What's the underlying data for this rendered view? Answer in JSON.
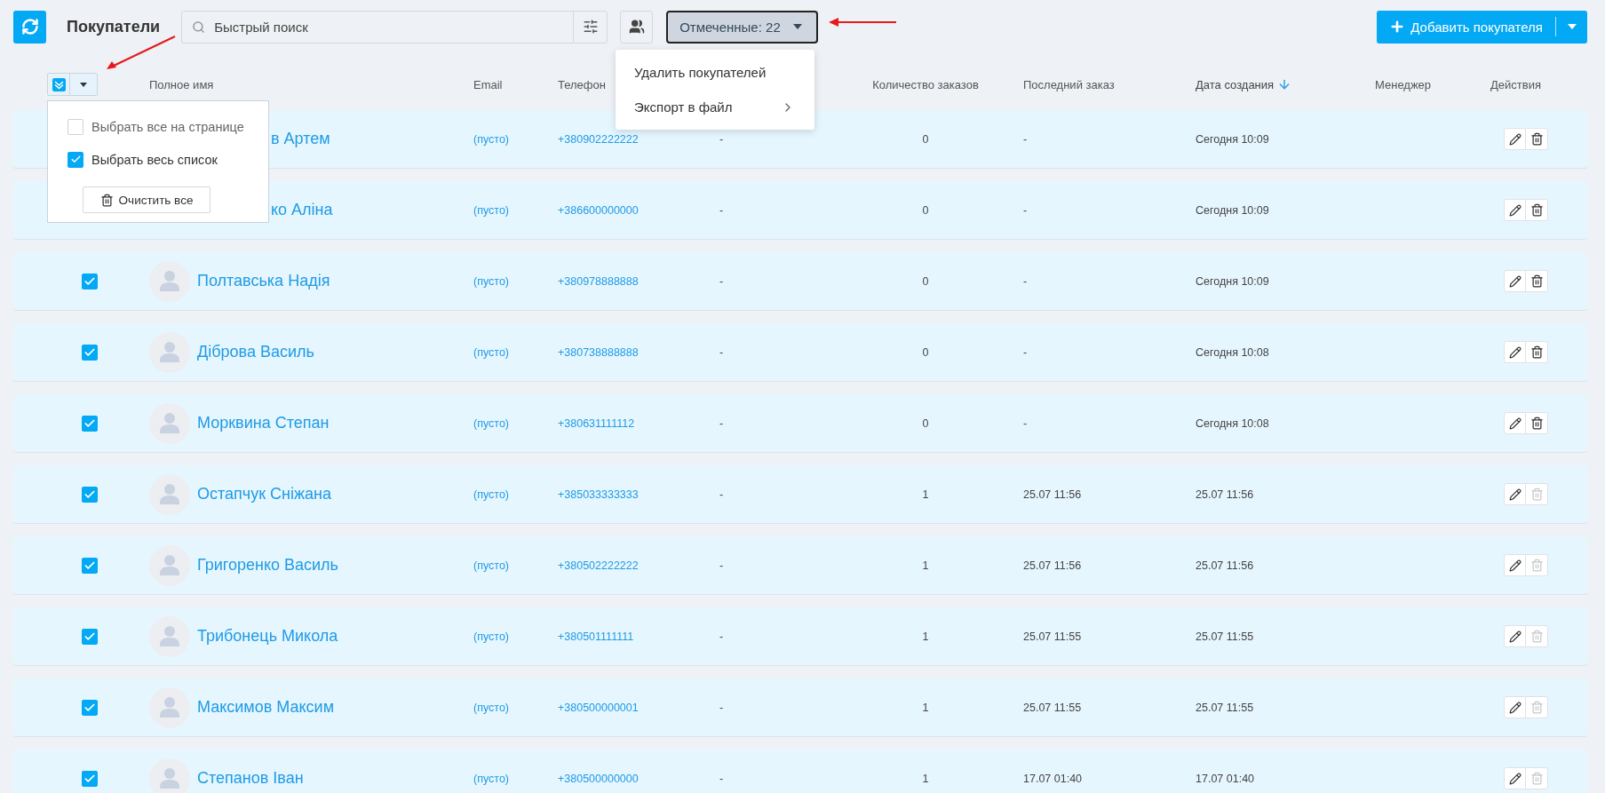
{
  "toolbar": {
    "title": "Покупатели",
    "search_placeholder": "Быстрый поиск",
    "marked_button": "Отмеченные: 22",
    "add_button": "Добавить покупателя"
  },
  "marked_menu": {
    "items": [
      {
        "label": "Удалить покупателей",
        "kind": "plain"
      },
      {
        "label": "Экспорт в файл",
        "kind": "submenu"
      }
    ]
  },
  "select_menu": {
    "header_checked": true,
    "options": [
      {
        "label": "Выбрать все на странице",
        "checked": false
      },
      {
        "label": "Выбрать весь список",
        "checked": true
      }
    ],
    "clear_button": "Очистить все"
  },
  "columns": [
    {
      "label": "Полное имя",
      "sorted": false
    },
    {
      "label": "Email",
      "sorted": false
    },
    {
      "label": "Телефон",
      "sorted": false
    },
    {
      "label": "Количество заказов",
      "sorted": false
    },
    {
      "label": "Последний заказ",
      "sorted": false
    },
    {
      "label": "Дата создания",
      "sorted": true
    },
    {
      "label": "Менеджер",
      "sorted": false
    },
    {
      "label": "Действия",
      "sorted": false
    }
  ],
  "rows": [
    {
      "kind": "covered",
      "name": "в Артем",
      "email": "(пусто)",
      "phone": "+380902222222",
      "column_4": "-",
      "orders": "0",
      "last_order": "-",
      "created": "Сегодня 10:09",
      "delete_disabled": false
    },
    {
      "kind": "covered",
      "name": "ко Аліна",
      "email": "(пусто)",
      "phone": "+386600000000",
      "column_4": "-",
      "orders": "0",
      "last_order": "-",
      "created": "Сегодня 10:09",
      "delete_disabled": false
    },
    {
      "kind": "full",
      "checked": true,
      "name": "Полтавська Надія",
      "email": "(пусто)",
      "phone": "+380978888888",
      "column_4": "-",
      "orders": "0",
      "last_order": "-",
      "created": "Сегодня 10:09",
      "delete_disabled": false
    },
    {
      "kind": "full",
      "checked": true,
      "name": "Діброва Василь",
      "email": "(пусто)",
      "phone": "+380738888888",
      "column_4": "-",
      "orders": "0",
      "last_order": "-",
      "created": "Сегодня 10:08",
      "delete_disabled": false
    },
    {
      "kind": "full",
      "checked": true,
      "name": "Морквина Степан",
      "email": "(пусто)",
      "phone": "+380631111112",
      "column_4": "-",
      "orders": "0",
      "last_order": "-",
      "created": "Сегодня 10:08",
      "delete_disabled": false
    },
    {
      "kind": "full",
      "checked": true,
      "name": "Остапчук Сніжана",
      "email": "(пусто)",
      "phone": "+385033333333",
      "column_4": "-",
      "orders": "1",
      "last_order": "25.07 11:56",
      "created": "25.07 11:56",
      "delete_disabled": true
    },
    {
      "kind": "full",
      "checked": true,
      "name": "Григоренко Василь",
      "email": "(пусто)",
      "phone": "+380502222222",
      "column_4": "-",
      "orders": "1",
      "last_order": "25.07 11:56",
      "created": "25.07 11:56",
      "delete_disabled": true
    },
    {
      "kind": "full",
      "checked": true,
      "name": "Трибонець Микола",
      "email": "(пусто)",
      "phone": "+380501111111",
      "column_4": "-",
      "orders": "1",
      "last_order": "25.07 11:55",
      "created": "25.07 11:55",
      "delete_disabled": true
    },
    {
      "kind": "full",
      "checked": true,
      "name": "Максимов Максим",
      "email": "(пусто)",
      "phone": "+380500000001",
      "column_4": "-",
      "orders": "1",
      "last_order": "25.07 11:55",
      "created": "25.07 11:55",
      "delete_disabled": true
    },
    {
      "kind": "full",
      "checked": true,
      "name": "Степанов Іван",
      "email": "(пусто)",
      "phone": "+380500000000",
      "column_4": "-",
      "orders": "1",
      "last_order": "17.07 01:40",
      "created": "17.07 01:40",
      "delete_disabled": true
    }
  ]
}
